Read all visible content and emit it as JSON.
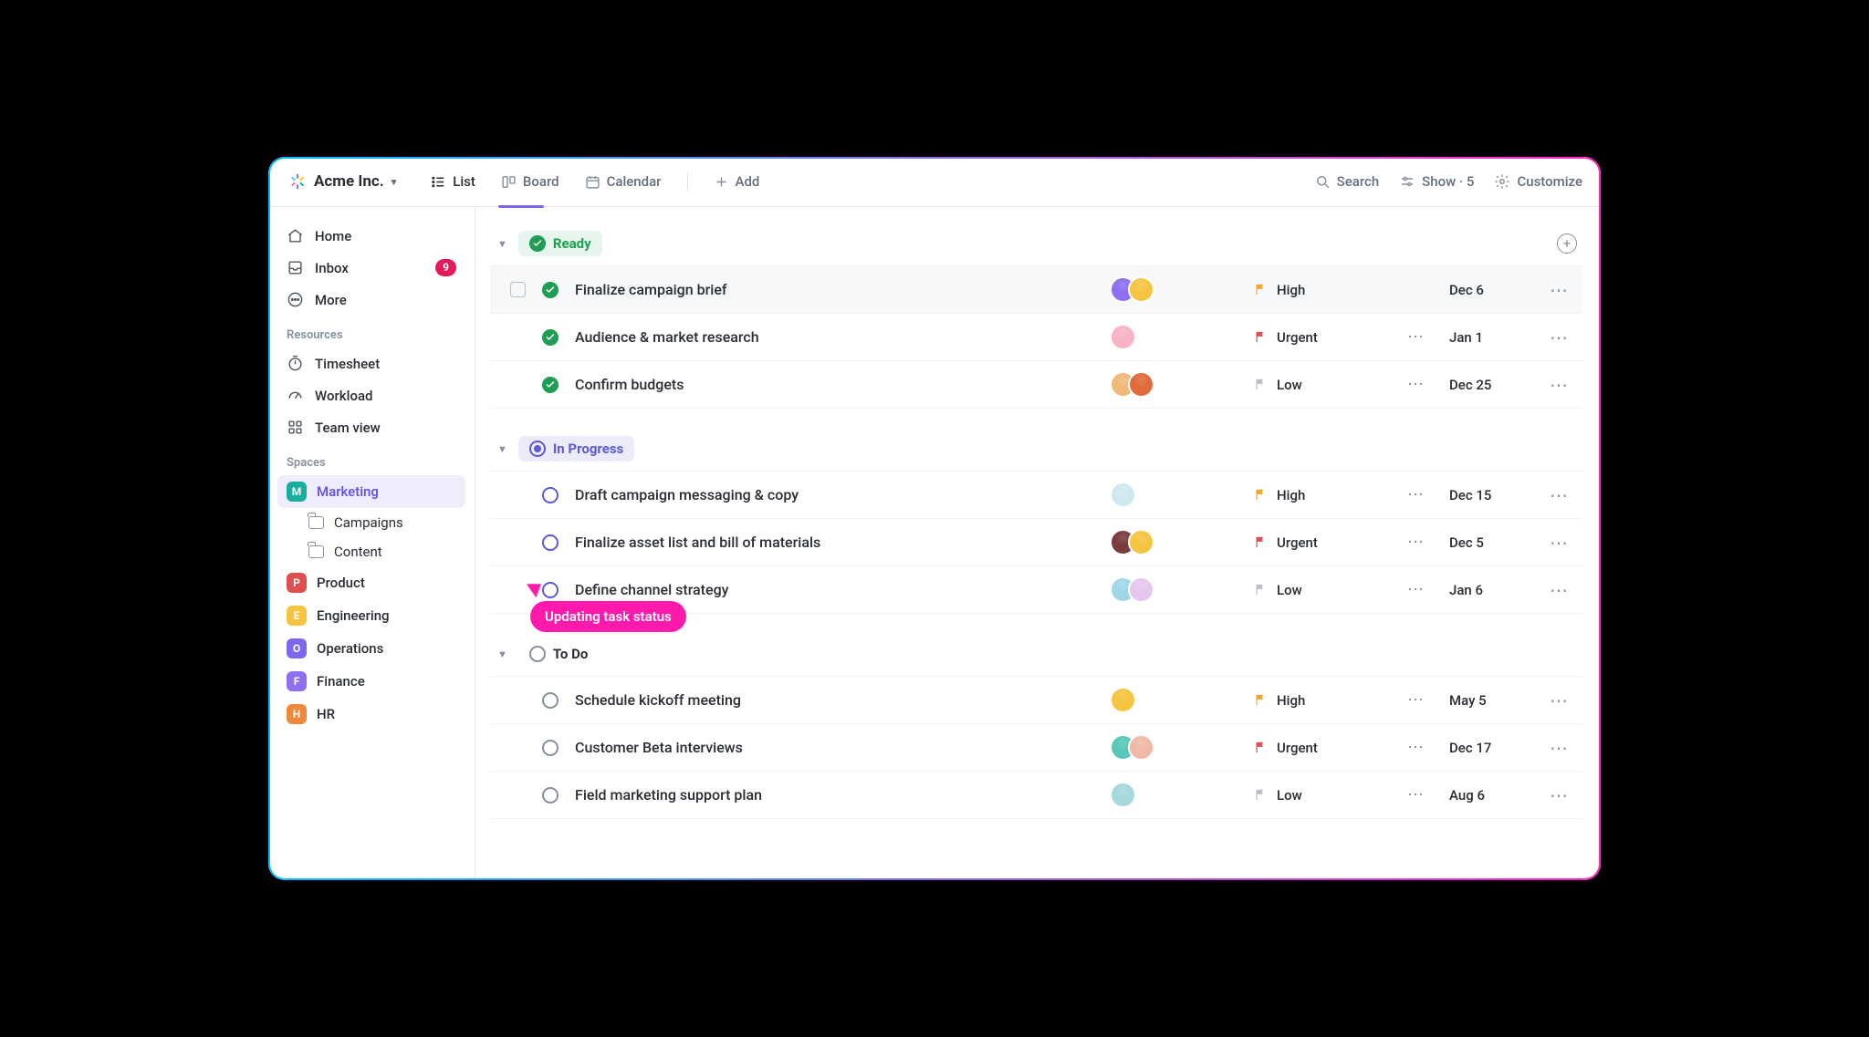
{
  "workspace_name": "Acme Inc.",
  "views": {
    "list": "List",
    "board": "Board",
    "calendar": "Calendar",
    "add": "Add"
  },
  "tools": {
    "search": "Search",
    "show": "Show · 5",
    "customize": "Customize"
  },
  "sidebar": {
    "home": "Home",
    "inbox": "Inbox",
    "inbox_count": "9",
    "more": "More",
    "resources_heading": "Resources",
    "timesheet": "Timesheet",
    "workload": "Workload",
    "teamview": "Team view",
    "spaces_heading": "Spaces",
    "spaces": {
      "marketing": {
        "letter": "M",
        "label": "Marketing",
        "color": "#1aae9f"
      },
      "campaigns": "Campaigns",
      "content": "Content",
      "product": {
        "letter": "P",
        "label": "Product",
        "color": "#e04f4f"
      },
      "engineering": {
        "letter": "E",
        "label": "Engineering",
        "color": "#f5c542"
      },
      "operations": {
        "letter": "O",
        "label": "Operations",
        "color": "#7b68ee"
      },
      "finance": {
        "letter": "F",
        "label": "Finance",
        "color": "#8e6ff0"
      },
      "hr": {
        "letter": "H",
        "label": "HR",
        "color": "#f0883b"
      }
    }
  },
  "cursor_tip": "Updating task status",
  "priority_labels": {
    "high": "High",
    "urgent": "Urgent",
    "low": "Low"
  },
  "priority_colors": {
    "high": "#f5a623",
    "urgent": "#e04f4f",
    "low": "#b9bec7"
  },
  "groups": [
    {
      "key": "ready",
      "label": "Ready",
      "style": "ready",
      "tasks": [
        {
          "title": "Finalize campaign brief",
          "priority": "high",
          "date": "Dec 6",
          "show_check": true,
          "show_ell": false,
          "hov": true,
          "avatars": [
            "#8e6ff0",
            "#f5c542"
          ]
        },
        {
          "title": "Audience & market research",
          "priority": "urgent",
          "date": "Jan 1",
          "show_check": false,
          "show_ell": true,
          "avatars": [
            "#f8b4c4"
          ]
        },
        {
          "title": "Confirm budgets",
          "priority": "low",
          "date": "Dec 25",
          "show_check": false,
          "show_ell": true,
          "avatars": [
            "#f0b97a",
            "#e06a3b"
          ]
        }
      ]
    },
    {
      "key": "progress",
      "label": "In Progress",
      "style": "progress",
      "tasks": [
        {
          "title": "Draft campaign messaging & copy",
          "priority": "high",
          "date": "Dec 15",
          "show_check": false,
          "show_ell": true,
          "avatars": [
            "#cfe8ef"
          ]
        },
        {
          "title": "Finalize asset list and bill of materials",
          "priority": "urgent",
          "date": "Dec 5",
          "show_check": false,
          "show_ell": true,
          "avatars": [
            "#7a3b3b",
            "#f5c542"
          ]
        },
        {
          "title": "Define channel strategy",
          "priority": "low",
          "date": "Jan 6",
          "show_check": false,
          "show_ell": true,
          "avatars": [
            "#9fd7e8",
            "#e6c6ef"
          ]
        }
      ]
    },
    {
      "key": "todo",
      "label": "To Do",
      "style": "todo",
      "tasks": [
        {
          "title": "Schedule kickoff meeting",
          "priority": "high",
          "date": "May 5",
          "show_check": false,
          "show_ell": true,
          "avatars": [
            "#f5c542"
          ]
        },
        {
          "title": "Customer Beta interviews",
          "priority": "urgent",
          "date": "Dec 17",
          "show_check": false,
          "show_ell": true,
          "avatars": [
            "#5ac7b8",
            "#f0b9a6"
          ]
        },
        {
          "title": "Field marketing support plan",
          "priority": "low",
          "date": "Aug 6",
          "show_check": false,
          "show_ell": true,
          "avatars": [
            "#a6d8db"
          ]
        }
      ]
    }
  ]
}
